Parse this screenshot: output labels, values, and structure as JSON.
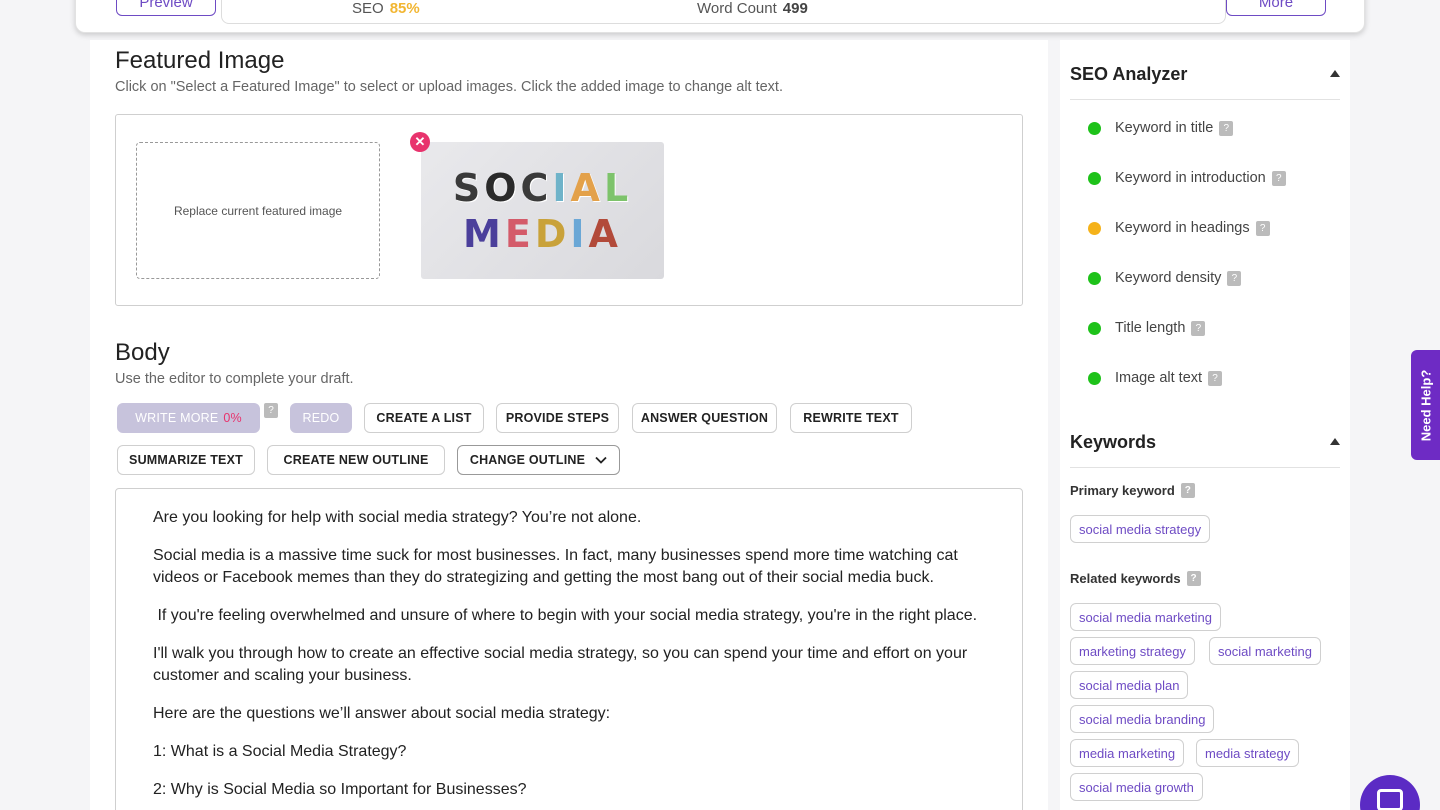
{
  "topbar": {
    "preview_label": "Preview",
    "seo_label": "SEO",
    "seo_value": "85%",
    "wordcount_label": "Word Count",
    "wordcount_value": "499",
    "more_label": "More"
  },
  "featured": {
    "title": "Featured Image",
    "subtitle": "Click on \"Select a Featured Image\" to select or upload images. Click the added image to change alt text.",
    "dropzone_label": "Replace current featured image",
    "image_line1": [
      "S",
      "O",
      "C",
      "I",
      "A",
      "L"
    ],
    "image_line2": [
      "M",
      "E",
      "D",
      "I",
      "A"
    ]
  },
  "body": {
    "title": "Body",
    "subtitle": "Use the editor to complete your draft.",
    "buttons": {
      "write_more": "WRITE MORE",
      "write_more_pct": "0%",
      "redo": "REDO",
      "create_list": "CREATE A LIST",
      "provide_steps": "PROVIDE STEPS",
      "answer_question": "ANSWER QUESTION",
      "rewrite_text": "REWRITE TEXT",
      "summarize_text": "SUMMARIZE TEXT",
      "create_outline": "CREATE NEW OUTLINE",
      "change_outline": "CHANGE OUTLINE"
    },
    "help_glyph": "?",
    "paragraphs": [
      "Are you looking for help with social media strategy? You’re not alone.",
      "Social media is a massive time suck for most businesses. In fact, many businesses spend more time watching cat videos or Facebook memes than they do strategizing and getting the most bang out of their social media buck.",
      " If you're feeling overwhelmed and unsure of where to begin with your social media strategy, you're in the right place.",
      "I'll walk you through how to create an effective social media strategy, so you can spend your time and effort on your customer and scaling your business.",
      "Here are the questions we’ll answer about social media strategy:",
      "1: What is a Social Media Strategy?",
      "2: Why is Social Media so Important for Businesses?"
    ]
  },
  "seo_analyzer": {
    "title": "SEO Analyzer",
    "items": [
      {
        "label": "Keyword in title",
        "status": "green"
      },
      {
        "label": "Keyword in introduction",
        "status": "green"
      },
      {
        "label": "Keyword in headings",
        "status": "orange"
      },
      {
        "label": "Keyword density",
        "status": "green"
      },
      {
        "label": "Title length",
        "status": "green"
      },
      {
        "label": "Image alt text",
        "status": "green"
      }
    ]
  },
  "keywords": {
    "title": "Keywords",
    "primary_label": "Primary keyword",
    "primary": [
      "social media strategy"
    ],
    "related_label": "Related keywords",
    "related": [
      "social media marketing",
      "marketing strategy",
      "social marketing",
      "social media plan",
      "social media branding",
      "media marketing",
      "media strategy",
      "social media growth"
    ]
  },
  "need_help_label": "Need Help?",
  "colors": {
    "accent": "#6e4bc4",
    "green": "#1ec21a",
    "orange": "#f5b21a",
    "pink": "#e8336d"
  }
}
